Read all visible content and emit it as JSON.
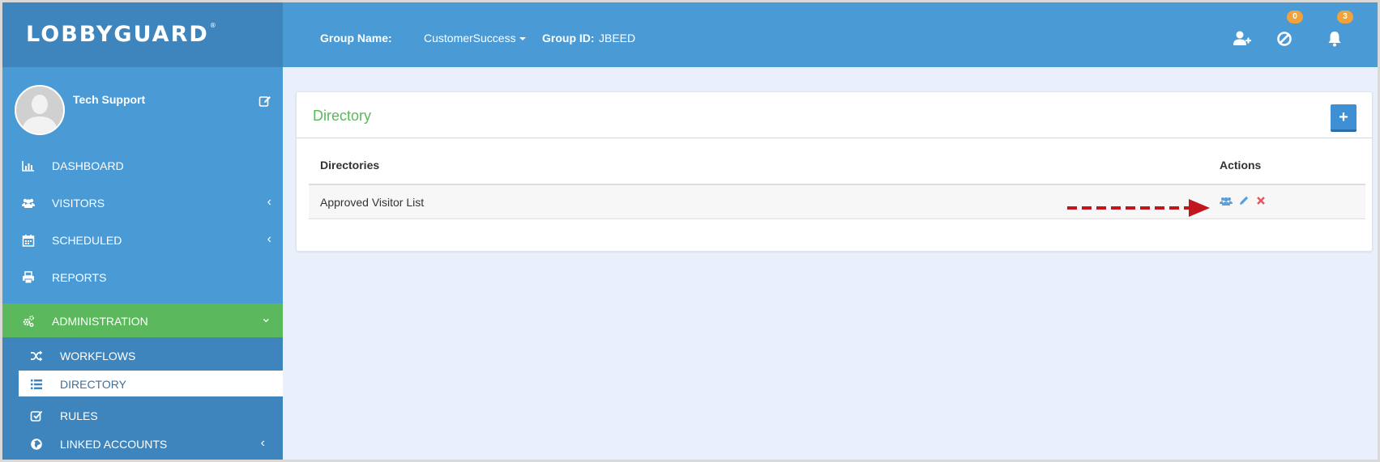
{
  "brand": {
    "logo_text": "LOBBYGUARD",
    "reg_mark": "®"
  },
  "header": {
    "group_name_label": "Group Name:",
    "group_name_value": "CustomerSuccess",
    "group_id_label": "Group ID:",
    "group_id_value": "JBEED",
    "icons": [
      "add-user-icon",
      "ban-icon",
      "bell-icon"
    ],
    "badges": {
      "ban": "0",
      "bell": "3"
    }
  },
  "sidebar": {
    "user": {
      "name": "Tech Support"
    },
    "items": [
      {
        "label": "DASHBOARD",
        "icon": "bar-chart-icon"
      },
      {
        "label": "VISITORS",
        "icon": "users-icon",
        "chevron": "‹"
      },
      {
        "label": "SCHEDULED",
        "icon": "calendar-icon",
        "chevron": "‹"
      },
      {
        "label": "REPORTS",
        "icon": "print-icon"
      },
      {
        "label": "ADMINISTRATION",
        "icon": "cogs-icon",
        "chevron": "⌄",
        "active": true
      }
    ],
    "sub_items": [
      {
        "label": "WORKFLOWS",
        "icon": "random-icon"
      },
      {
        "label": "DIRECTORY",
        "icon": "list-icon",
        "active": true
      },
      {
        "label": "RULES",
        "icon": "edit-check-icon"
      },
      {
        "label": "LINKED ACCOUNTS",
        "icon": "globe-icon",
        "chevron": "‹"
      }
    ]
  },
  "main": {
    "title": "Directory",
    "add_label": "+",
    "table": {
      "columns": [
        "Directories",
        "Actions"
      ],
      "rows": [
        {
          "name": "Approved Visitor List",
          "actions": [
            "users-icon",
            "pencil-icon",
            "delete-icon"
          ]
        }
      ]
    }
  },
  "colors": {
    "primary": "#4a9ad6",
    "primary_dark": "#3e85bd",
    "success": "#5cb85c",
    "badge": "#f0a33c",
    "arrow": "#c0161c",
    "background": "#eaf0fb"
  }
}
